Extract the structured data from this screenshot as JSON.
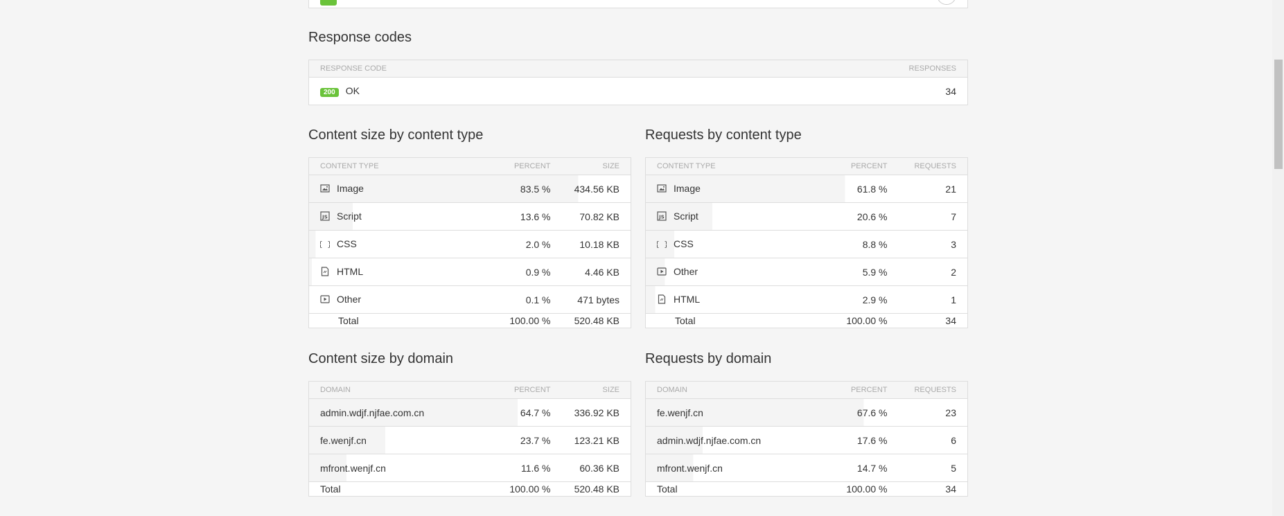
{
  "response_codes": {
    "title": "Response codes",
    "col_code": "Response code",
    "col_responses": "Responses",
    "rows": [
      {
        "code": "200",
        "text": "OK",
        "responses": "34"
      }
    ]
  },
  "size_by_type": {
    "title": "Content size by content type",
    "cols": [
      "Content type",
      "Percent",
      "Size"
    ],
    "rows": [
      {
        "icon": "image-icon",
        "label": "Image",
        "percent": "83.5 %",
        "value": "434.56 KB",
        "fraction": 0.835
      },
      {
        "icon": "script-icon",
        "label": "Script",
        "percent": "13.6 %",
        "value": "70.82 KB",
        "fraction": 0.136
      },
      {
        "icon": "css-icon",
        "label": "CSS",
        "percent": "2.0 %",
        "value": "10.18 KB",
        "fraction": 0.02
      },
      {
        "icon": "html-icon",
        "label": "HTML",
        "percent": "0.9 %",
        "value": "4.46 KB",
        "fraction": 0.009
      },
      {
        "icon": "other-icon",
        "label": "Other",
        "percent": "0.1 %",
        "value": "471 bytes",
        "fraction": 0.001
      }
    ],
    "total": {
      "label": "Total",
      "percent": "100.00 %",
      "value": "520.48 KB"
    }
  },
  "requests_by_type": {
    "title": "Requests by content type",
    "cols": [
      "Content type",
      "Percent",
      "Requests"
    ],
    "rows": [
      {
        "icon": "image-icon",
        "label": "Image",
        "percent": "61.8 %",
        "value": "21",
        "fraction": 0.618
      },
      {
        "icon": "script-icon",
        "label": "Script",
        "percent": "20.6 %",
        "value": "7",
        "fraction": 0.206
      },
      {
        "icon": "css-icon",
        "label": "CSS",
        "percent": "8.8 %",
        "value": "3",
        "fraction": 0.088
      },
      {
        "icon": "other-icon",
        "label": "Other",
        "percent": "5.9 %",
        "value": "2",
        "fraction": 0.059
      },
      {
        "icon": "html-icon",
        "label": "HTML",
        "percent": "2.9 %",
        "value": "1",
        "fraction": 0.029
      }
    ],
    "total": {
      "label": "Total",
      "percent": "100.00 %",
      "value": "34"
    }
  },
  "size_by_domain": {
    "title": "Content size by domain",
    "cols": [
      "Domain",
      "Percent",
      "Size"
    ],
    "rows": [
      {
        "label": "admin.wdjf.njfae.com.cn",
        "percent": "64.7 %",
        "value": "336.92 KB",
        "fraction": 0.647
      },
      {
        "label": "fe.wenjf.cn",
        "percent": "23.7 %",
        "value": "123.21 KB",
        "fraction": 0.237
      },
      {
        "label": "mfront.wenjf.cn",
        "percent": "11.6 %",
        "value": "60.36 KB",
        "fraction": 0.116
      }
    ],
    "total": {
      "label": "Total",
      "percent": "100.00 %",
      "value": "520.48 KB"
    }
  },
  "requests_by_domain": {
    "title": "Requests by domain",
    "cols": [
      "Domain",
      "Percent",
      "Requests"
    ],
    "rows": [
      {
        "label": "fe.wenjf.cn",
        "percent": "67.6 %",
        "value": "23",
        "fraction": 0.676
      },
      {
        "label": "admin.wdjf.njfae.com.cn",
        "percent": "17.6 %",
        "value": "6",
        "fraction": 0.176
      },
      {
        "label": "mfront.wenjf.cn",
        "percent": "14.7 %",
        "value": "5",
        "fraction": 0.147
      }
    ],
    "total": {
      "label": "Total",
      "percent": "100.00 %",
      "value": "34"
    }
  },
  "colors": {
    "badge_green": "#6ac33a",
    "bar_fill": "#f4f4f4",
    "border": "#dddddd"
  }
}
